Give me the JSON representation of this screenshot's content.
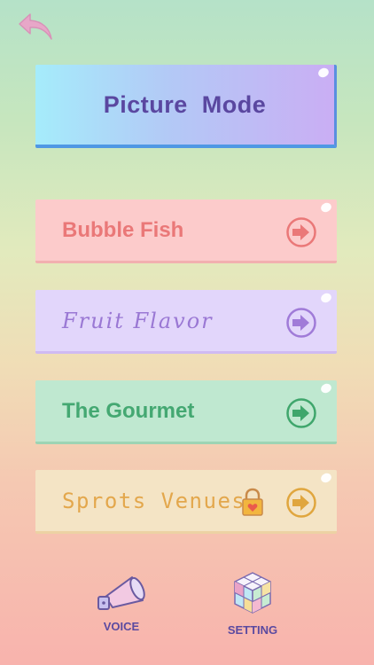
{
  "header": {
    "back_icon": "back-arrow-icon"
  },
  "title_panel": {
    "title": "Picture  Mode"
  },
  "modes": [
    {
      "label": "Bubble Fish",
      "color": "#ea7878",
      "locked": false
    },
    {
      "label": "Fruit Flavor",
      "color": "#9a78d4",
      "locked": false
    },
    {
      "label": "The Gourmet",
      "color": "#44a872",
      "locked": false
    },
    {
      "label": "Sprots Venues",
      "color": "#e3a74c",
      "locked": true
    }
  ],
  "footer": {
    "voice": {
      "label": "VOICE",
      "icon": "megaphone-icon"
    },
    "setting": {
      "label": "SETTING",
      "icon": "cube-icon"
    }
  }
}
